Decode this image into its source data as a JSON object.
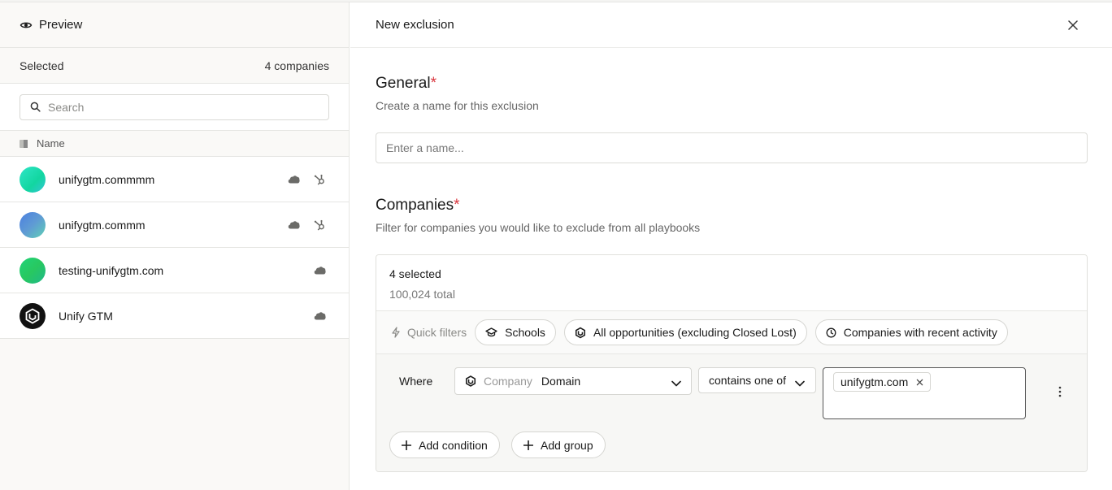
{
  "left": {
    "title": "Preview",
    "selected_label": "Selected",
    "selected_count": "4 companies",
    "search_placeholder": "Search",
    "column_name": "Name",
    "rows": [
      {
        "name": "unifygtm.commmm",
        "salesforce": true,
        "hubspot": true,
        "avatar": "gradient-teal"
      },
      {
        "name": "unifygtm.commm",
        "salesforce": true,
        "hubspot": true,
        "avatar": "gradient-blue"
      },
      {
        "name": "testing-unifygtm.com",
        "salesforce": true,
        "hubspot": false,
        "avatar": "gradient-green"
      },
      {
        "name": "Unify GTM",
        "salesforce": true,
        "hubspot": false,
        "avatar": "unify-logo"
      }
    ]
  },
  "right": {
    "title": "New exclusion",
    "general": {
      "title": "General",
      "required_mark": "*",
      "subtitle": "Create a name for this exclusion",
      "name_placeholder": "Enter a name..."
    },
    "companies": {
      "title": "Companies",
      "required_mark": "*",
      "subtitle": "Filter for companies you would like to exclude from all playbooks",
      "selected": "4 selected",
      "total": "100,024 total",
      "quick_filters_label": "Quick filters",
      "quick_filters": [
        {
          "label": "Schools",
          "icon": "graduation-cap-icon"
        },
        {
          "label": "All opportunities (excluding Closed Lost)",
          "icon": "salesforce-hex-icon"
        },
        {
          "label": "Companies with recent activity",
          "icon": "clock-icon"
        }
      ],
      "condition": {
        "where_label": "Where",
        "object": "Company",
        "field": "Domain",
        "operator": "contains one of",
        "values": [
          "unifygtm.com"
        ]
      },
      "add_condition": "Add condition",
      "add_group": "Add group"
    }
  },
  "colors": {
    "required": "#d9363e",
    "border": "#e6e6e3",
    "panel_bg": "#faf9f7"
  }
}
